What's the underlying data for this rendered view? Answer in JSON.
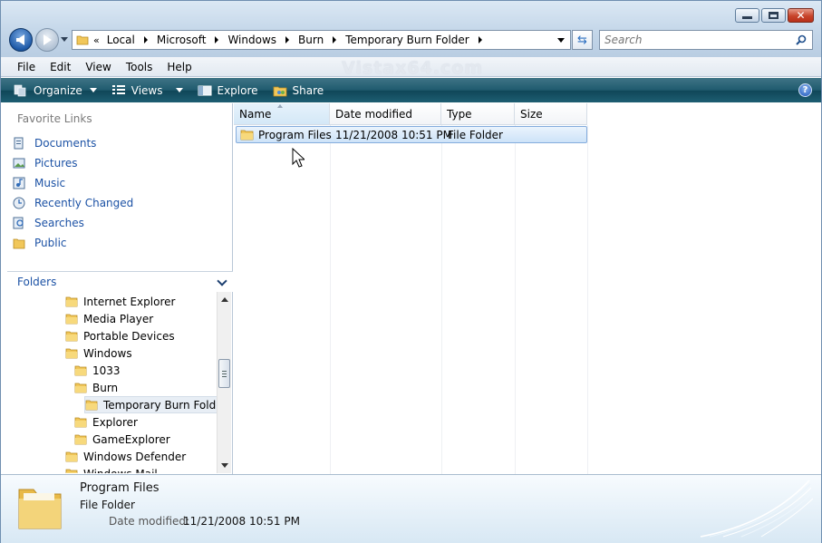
{
  "window": {
    "buttons": {
      "minimize": "minimize-icon",
      "maximize": "maximize-icon",
      "close": "close-icon"
    }
  },
  "address": {
    "overflow_glyph": "«",
    "breadcrumbs": [
      "Local",
      "Microsoft",
      "Windows",
      "Burn",
      "Temporary Burn Folder"
    ]
  },
  "search": {
    "placeholder": "Search"
  },
  "menu": {
    "items": [
      "File",
      "Edit",
      "View",
      "Tools",
      "Help"
    ]
  },
  "watermark": "Vistax64.com",
  "toolbar": {
    "organize": "Organize",
    "views": "Views",
    "explore": "Explore",
    "share": "Share",
    "help_glyph": "?"
  },
  "favorites": {
    "title": "Favorite Links",
    "items": [
      {
        "label": "Documents",
        "icon": "documents-icon"
      },
      {
        "label": "Pictures",
        "icon": "pictures-icon"
      },
      {
        "label": "Music",
        "icon": "music-icon"
      },
      {
        "label": "Recently Changed",
        "icon": "recently-changed-icon"
      },
      {
        "label": "Searches",
        "icon": "searches-icon"
      },
      {
        "label": "Public",
        "icon": "folder-icon"
      }
    ]
  },
  "folders": {
    "title": "Folders",
    "tree": [
      {
        "label": "Internet Explorer",
        "level": 0
      },
      {
        "label": "Media Player",
        "level": 0
      },
      {
        "label": "Portable Devices",
        "level": 0
      },
      {
        "label": "Windows",
        "level": 0
      },
      {
        "label": "1033",
        "level": 1
      },
      {
        "label": "Burn",
        "level": 1
      },
      {
        "label": "Temporary Burn Folder",
        "level": 2,
        "selected": true
      },
      {
        "label": "Explorer",
        "level": 1
      },
      {
        "label": "GameExplorer",
        "level": 1
      },
      {
        "label": "Windows Defender",
        "level": 0
      },
      {
        "label": "Windows Mail",
        "level": 0
      }
    ]
  },
  "columns": [
    "Name",
    "Date modified",
    "Type",
    "Size"
  ],
  "files": [
    {
      "name": "Program Files",
      "date": "11/21/2008 10:51 PM",
      "type": "File Folder",
      "size": ""
    }
  ],
  "details": {
    "name": "Program Files",
    "type": "File Folder",
    "date_label": "Date modified:",
    "date_value": "11/21/2008 10:51 PM"
  },
  "colors": {
    "accent": "#1c52a5",
    "toolbar": "#1f5a6e",
    "selection": "#cde3f8"
  }
}
